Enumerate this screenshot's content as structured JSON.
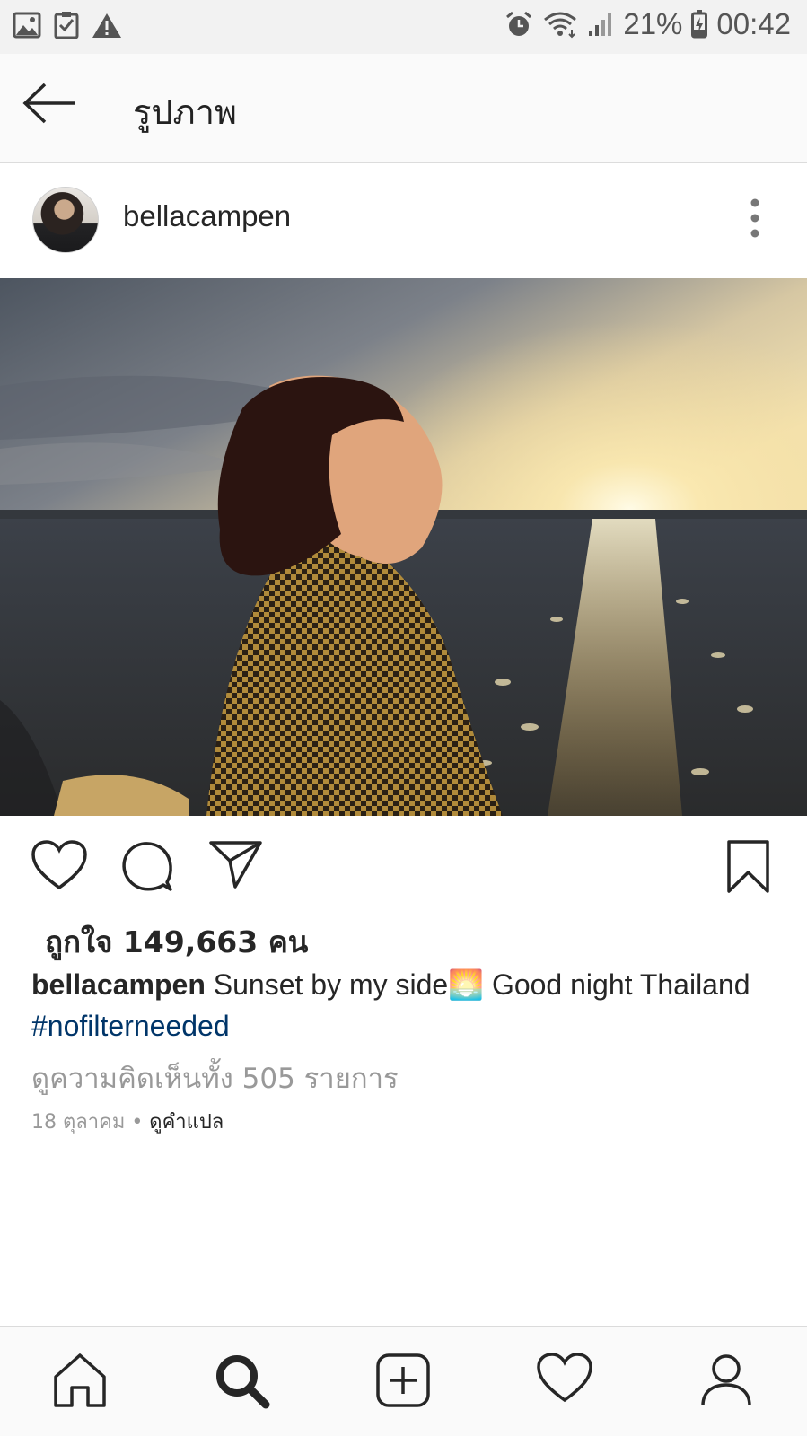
{
  "status_bar": {
    "battery": "21%",
    "time": "00:42",
    "left_icons": [
      "gallery-icon",
      "checklist-icon",
      "warning-icon"
    ],
    "right_icons": [
      "alarm-icon",
      "wifi-icon",
      "signal-icon",
      "battery-charging-icon"
    ]
  },
  "toolbar": {
    "title": "รูปภาพ",
    "back_icon": "arrow-left-icon"
  },
  "post": {
    "username": "bellacampen",
    "likes_text": "ถูกใจ 149,663 คน",
    "caption_user": "bellacampen",
    "caption_text": " Sunset by my side🌅 Good night Thailand",
    "hashtag": "#nofilterneeded",
    "view_comments": "ดูความคิดเห็นทั้ง 505 รายการ",
    "date": "18 ตุลาคม",
    "separator": " • ",
    "translate_link": "ดูคำแปล"
  },
  "action_icons": [
    "heart-icon",
    "comment-icon",
    "share-icon",
    "bookmark-icon"
  ],
  "bottom_nav": [
    "home-icon",
    "search-icon",
    "add-icon",
    "activity-icon",
    "profile-icon"
  ],
  "colors": {
    "hashtag": "#003569",
    "muted_text": "#999999",
    "status_bar_bg": "#f2f2f2",
    "toolbar_bg": "#fafafa"
  }
}
